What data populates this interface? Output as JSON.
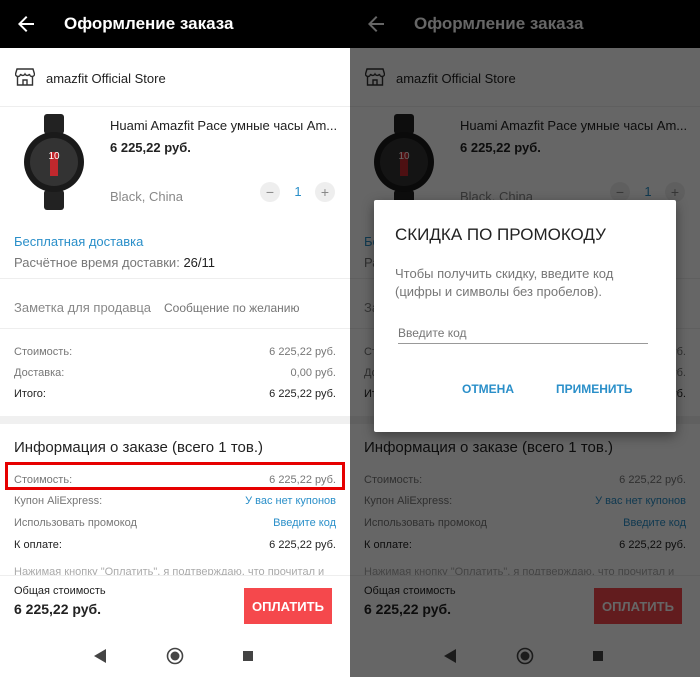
{
  "header": {
    "title": "Оформление заказа"
  },
  "store": {
    "name": "amazfit Official Store"
  },
  "product": {
    "title": "Huami Amazfit Pace умные часы Am...",
    "price": "6 225,22 руб.",
    "variant": "Black, China",
    "quantity": "1",
    "minus": "−",
    "plus": "+",
    "watch_text": "10"
  },
  "shipping": {
    "free_label": "Бесплатная доставка",
    "time_label": "Расчётное время доставки:",
    "time_value": "26/11"
  },
  "note": {
    "label": "Заметка для продавца",
    "placeholder": "Сообщение по желанию"
  },
  "summary": {
    "cost_label": "Стоимость:",
    "cost_value": "6 225,22 руб.",
    "delivery_label": "Доставка:",
    "delivery_value": "0,00 руб.",
    "total_label": "Итого:",
    "total_value": "6 225,22 руб."
  },
  "order_info": {
    "title": "Информация о заказе (всего 1 тов.)",
    "cost_label": "Стоимость:",
    "cost_value": "6 225,22 руб.",
    "coupon_label": "Купон AliExpress:",
    "coupon_value": "У вас нет купонов",
    "promo_label": "Использовать промокод",
    "promo_value": "Введите код",
    "pay_label": "К оплате:",
    "pay_value": "6 225,22 руб."
  },
  "disclaimer": "Нажимая кнопку \"Оплатить\", я подтверждаю, что прочитал и",
  "bottom": {
    "total_label": "Общая стоимость",
    "total_value": "6 225,22 руб.",
    "pay_button": "ОПЛАТИТЬ"
  },
  "dialog": {
    "title": "СКИДКА ПО ПРОМОКОДУ",
    "text": "Чтобы получить скидку, введите код (цифры и символы без пробелов).",
    "input_placeholder": "Введите код",
    "cancel": "ОТМЕНА",
    "apply": "ПРИМЕНИТЬ"
  },
  "icons": {
    "back": "arrow-left-icon",
    "store": "store-icon",
    "nav_back": "triangle-back-icon",
    "nav_home": "circle-home-icon",
    "nav_recents": "square-recents-icon"
  },
  "colors": {
    "accent_blue": "#2a8fc9",
    "pay_red": "#f5484c",
    "highlight_red": "#e60000",
    "appbar": "#000000"
  }
}
